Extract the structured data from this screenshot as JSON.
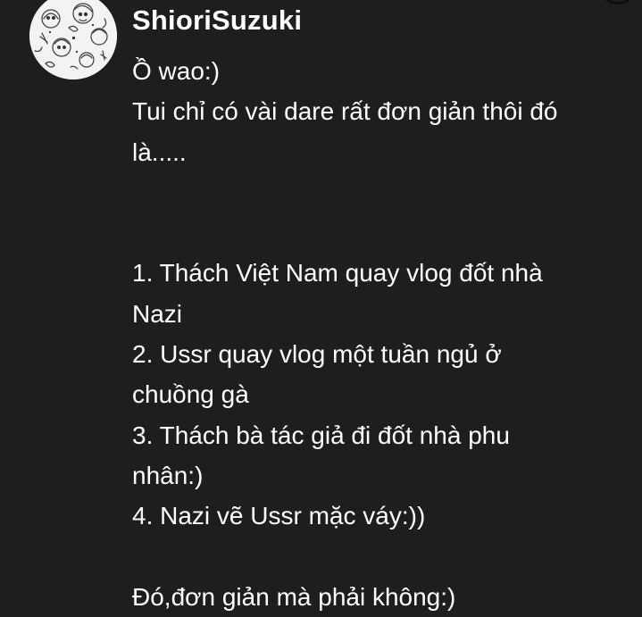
{
  "comment": {
    "username": "ShioriSuzuki",
    "avatar_icon": "sketch-avatar-icon",
    "lines": [
      "Ồ wao:)",
      "Tui chỉ có vài dare rất đơn giản thôi đó",
      "là.....",
      "",
      "",
      "1. Thách Việt Nam quay vlog đốt nhà",
      "Nazi",
      "2. Ussr quay vlog một tuần ngủ ở",
      "chuồng gà",
      "3. Thách bà tác giả đi đốt nhà phu",
      "nhân:)",
      "4. Nazi vẽ Ussr mặc váy:))",
      "",
      "Đó,đơn giản mà phải không:)"
    ]
  },
  "colors": {
    "background": "#1e1e1e",
    "text": "#ffffff"
  }
}
